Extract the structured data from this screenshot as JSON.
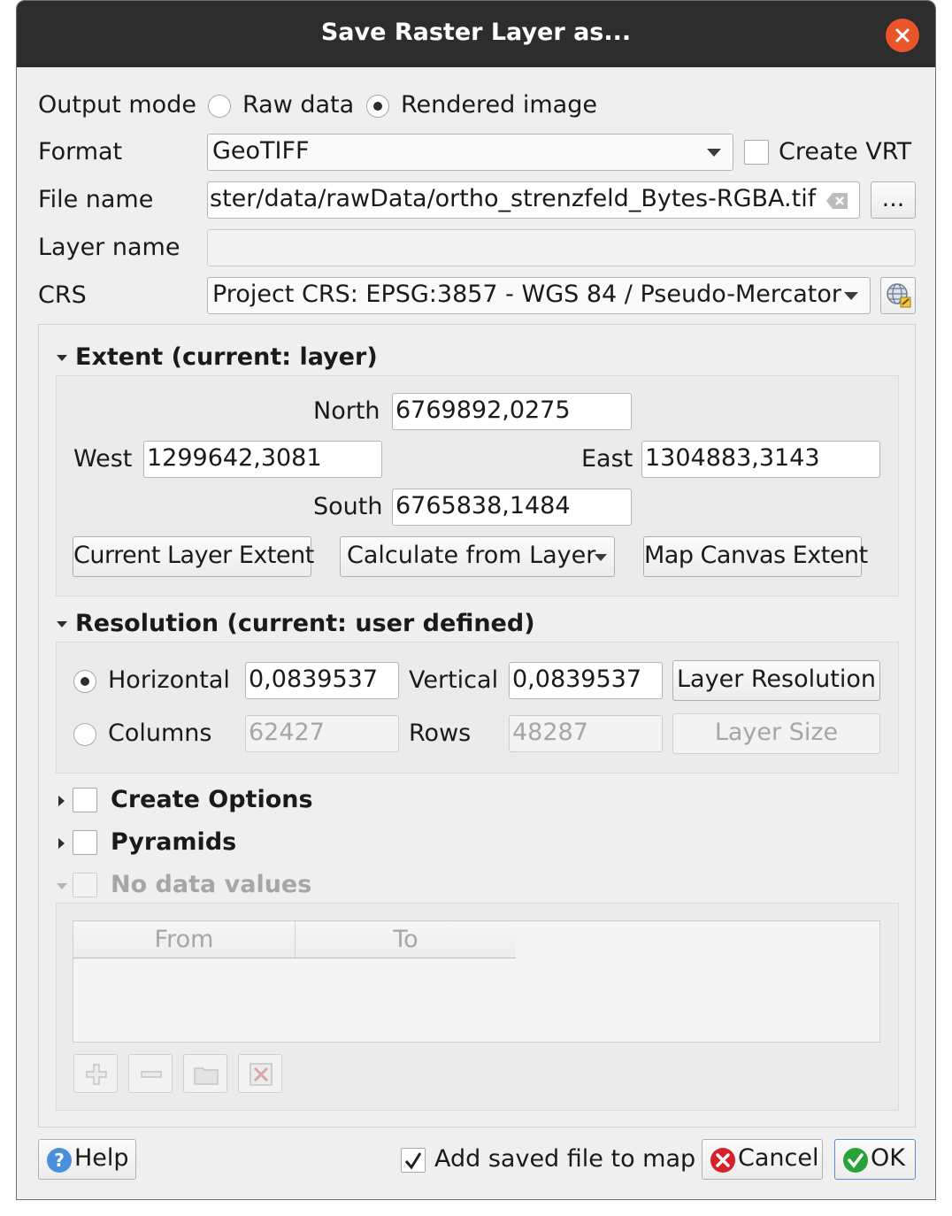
{
  "window": {
    "title": "Save Raster Layer as..."
  },
  "output_mode": {
    "label": "Output mode",
    "raw_label": "Raw data",
    "rendered_label": "Rendered image",
    "selected": "Rendered image"
  },
  "format": {
    "label": "Format",
    "value": "GeoTIFF",
    "vrt_label": "Create VRT"
  },
  "file_name": {
    "label": "File name",
    "value": "ster/data/rawData/ortho_strenzfeld_Bytes-RGBA.tif",
    "browse_label": "..."
  },
  "layer_name": {
    "label": "Layer name",
    "value": ""
  },
  "crs": {
    "label": "CRS",
    "value": "Project CRS: EPSG:3857 - WGS 84 / Pseudo-Mercator"
  },
  "extent": {
    "title": "Extent (current: layer)",
    "north_label": "North",
    "north": "6769892,0275",
    "west_label": "West",
    "west": "1299642,3081",
    "east_label": "East",
    "east": "1304883,3143",
    "south_label": "South",
    "south": "6765838,1484",
    "current_layer_btn": "Current Layer Extent",
    "calc_from_layer_btn": "Calculate from Layer",
    "map_canvas_btn": "Map Canvas Extent"
  },
  "resolution": {
    "title": "Resolution (current: user defined)",
    "horizontal_label": "Horizontal",
    "horizontal": "0,0839537",
    "vertical_label": "Vertical",
    "vertical": "0,0839537",
    "layer_resolution_btn": "Layer Resolution",
    "columns_label": "Columns",
    "columns": "62427",
    "rows_label": "Rows",
    "rows": "48287",
    "layer_size_btn": "Layer Size"
  },
  "sections": {
    "create_options": "Create Options",
    "pyramids": "Pyramids",
    "no_data": "No data values"
  },
  "nodata_table": {
    "headers": [
      "From",
      "To"
    ]
  },
  "footer": {
    "help": "Help",
    "add_to_map": "Add saved file to map",
    "cancel": "Cancel",
    "ok": "OK"
  },
  "icons": [
    "close-icon",
    "clear-text-icon",
    "globe-crs-icon",
    "help-icon",
    "cancel-icon",
    "ok-icon",
    "add-icon",
    "remove-icon",
    "open-folder-icon",
    "clear-all-icon"
  ]
}
